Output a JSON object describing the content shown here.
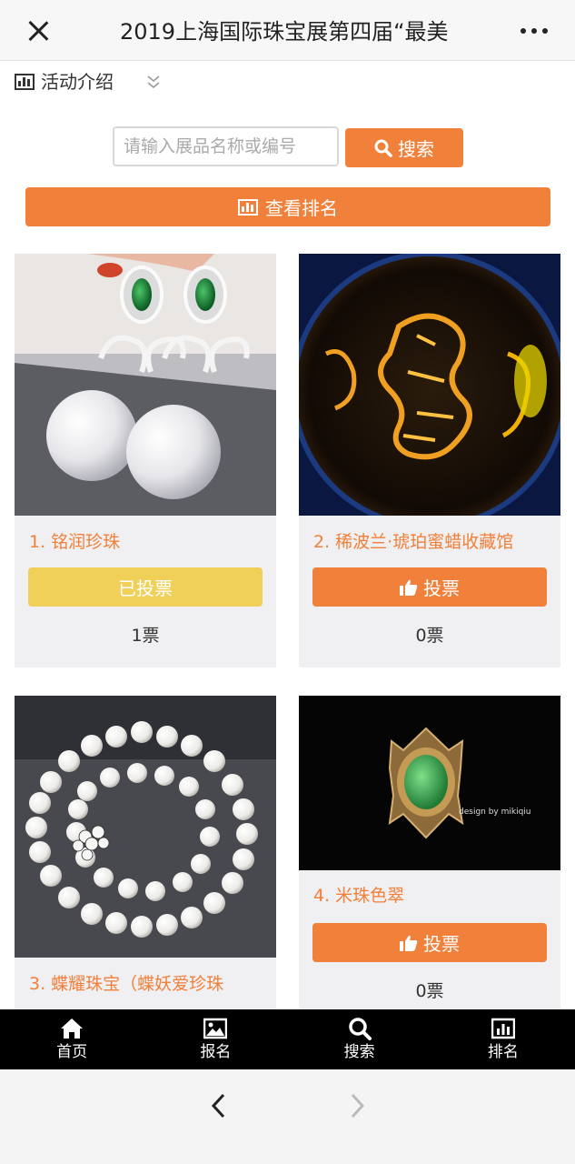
{
  "topbar": {
    "title": "2019上海国际珠宝展第四届“最美"
  },
  "intro": {
    "label": "活动介绍"
  },
  "search": {
    "placeholder": "请输入展品名称或编号",
    "button_label": "搜索"
  },
  "rank_button_label": "查看排名",
  "items": [
    {
      "name": "1. 铭润珍珠",
      "vote_label": "已投票",
      "voted": true,
      "count": "1票"
    },
    {
      "name": "2. 稀波兰·琥珀蜜蜡收藏馆",
      "vote_label": "投票",
      "voted": false,
      "count": "0票"
    },
    {
      "name": "3. 蝶耀珠宝（蝶妖爱珍珠",
      "vote_label": "",
      "voted": false,
      "count": ""
    },
    {
      "name": "4. 米珠色翠",
      "vote_label": "投票",
      "voted": false,
      "count": "0票",
      "image_caption": "design by mikiqiu"
    }
  ],
  "tabs": [
    {
      "label": "首页",
      "icon": "home-icon"
    },
    {
      "label": "报名",
      "icon": "image-icon"
    },
    {
      "label": "搜索",
      "icon": "search-icon"
    },
    {
      "label": "排名",
      "icon": "bar-chart-icon"
    }
  ],
  "colors": {
    "accent": "#f0803a",
    "voted": "#f1d05a",
    "card_bg": "#f0eff1",
    "tabbar_bg": "#000000"
  }
}
